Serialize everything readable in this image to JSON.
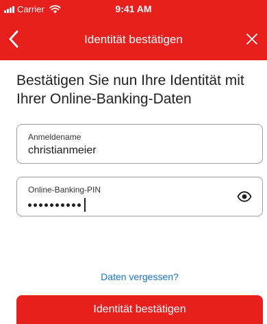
{
  "status_bar": {
    "carrier": "Carrier",
    "time": "9:41 AM"
  },
  "nav": {
    "title": "Identität bestätigen",
    "back_icon": "chevron-left-icon",
    "close_icon": "close-icon"
  },
  "content": {
    "heading": "Bestätigen Sie nun Ihre Identität mit Ihrer Online-Banking-Daten"
  },
  "form": {
    "username": {
      "label": "Anmeldename",
      "value": "christianmeier"
    },
    "pin": {
      "label": "Online-Banking-PIN",
      "masked_length": 10,
      "toggle_icon": "eye-icon"
    }
  },
  "links": {
    "forgot": "Daten vergessen?"
  },
  "actions": {
    "confirm": "Identität bestätigen"
  },
  "colors": {
    "brand": "#e8201d",
    "link": "#1a73c8",
    "border": "#9c9c9c",
    "text": "#1d1d1d"
  }
}
